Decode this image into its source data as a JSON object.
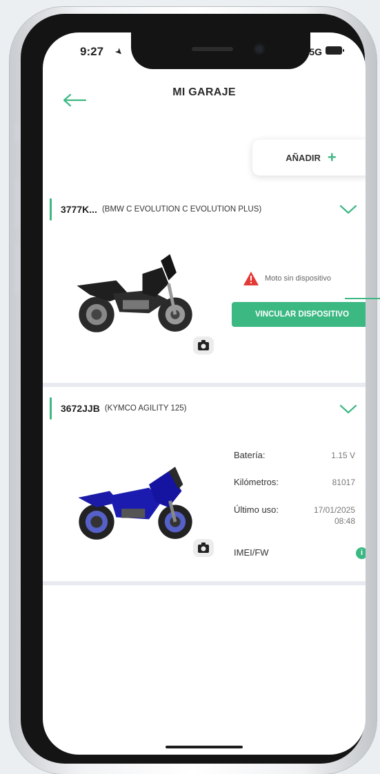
{
  "status_bar": {
    "time": "9:27",
    "network": "5G"
  },
  "header": {
    "title": "MI GARAJE"
  },
  "add_button": {
    "label": "AÑADIR",
    "icon": "plus-icon"
  },
  "colors": {
    "accent": "#3cb883",
    "warning": "#e53935",
    "bike1": "#1f1f1f",
    "bike2": "#1a1aa6"
  },
  "vehicles": [
    {
      "plate": "3777K...",
      "model": "(BMW C EVOLUTION C EVOLUTION PLUS)",
      "warning": "Moto sin dispositivo",
      "action": "VINCULAR DISPOSITIVO"
    },
    {
      "plate": "3672JJB",
      "model": "(KYMCO AGILITY 125)",
      "specs": [
        {
          "label": "Batería:",
          "value": "1.15 V"
        },
        {
          "label": "Kilómetros:",
          "value": "81017"
        },
        {
          "label": "Último uso:",
          "value": "17/01/2025",
          "value2": "08:48"
        },
        {
          "label": "IMEI/FW",
          "value": "i"
        }
      ]
    }
  ]
}
